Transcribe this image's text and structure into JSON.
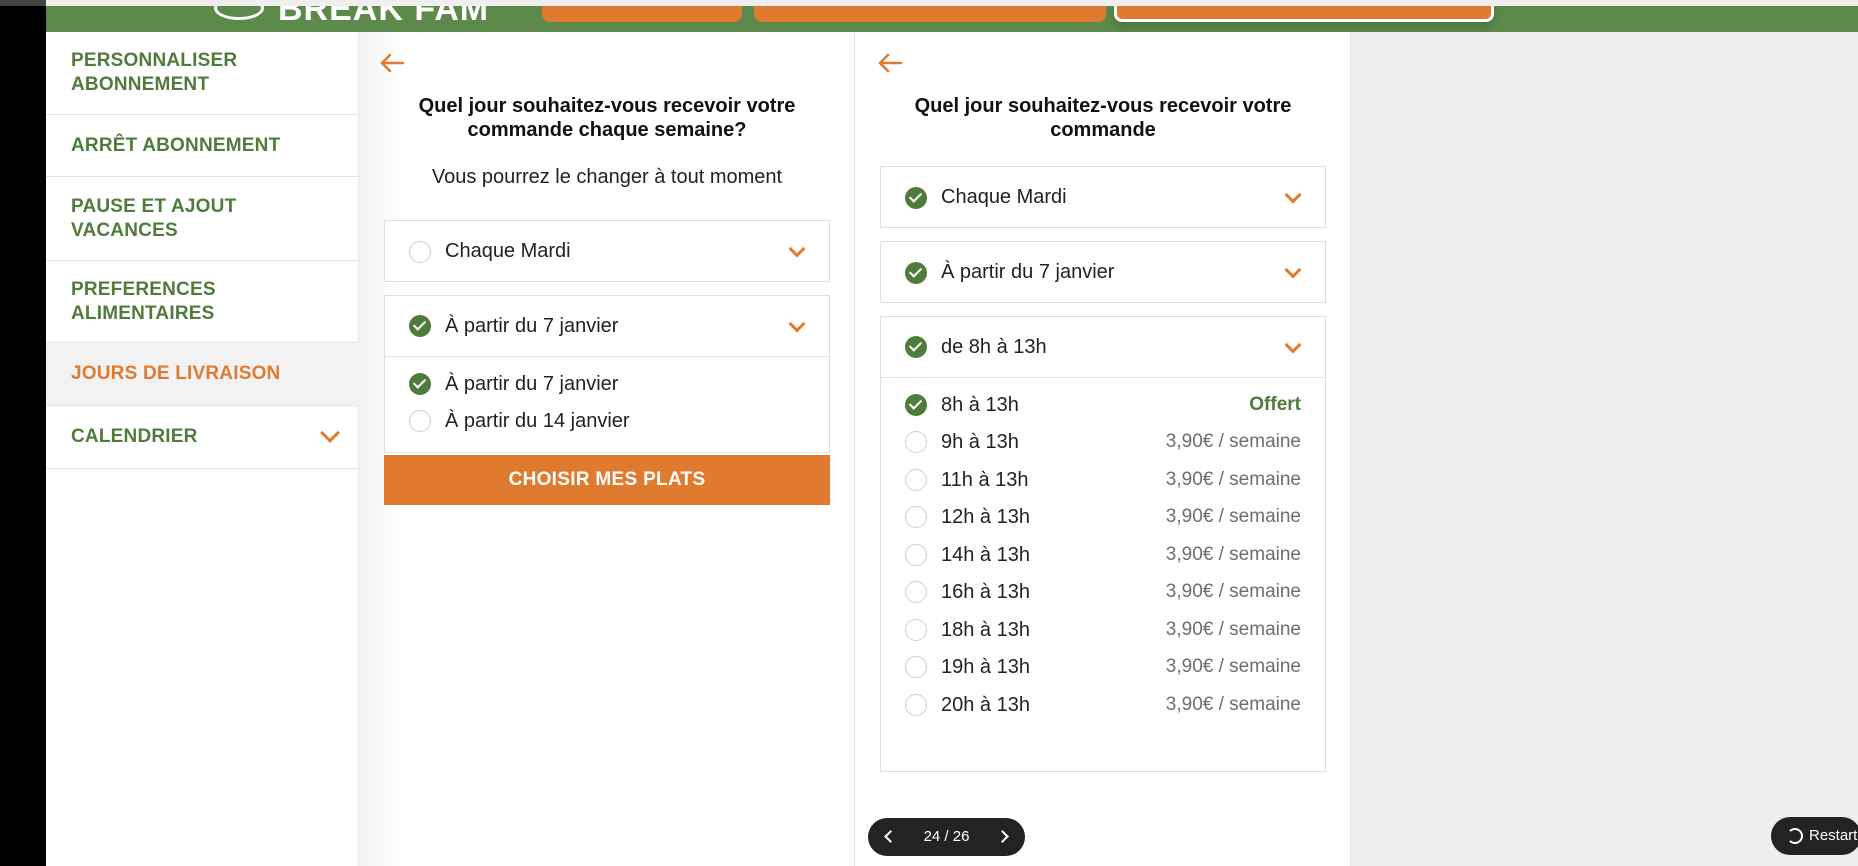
{
  "header": {
    "logo_text": "BREAK FAM"
  },
  "sidebar": {
    "items": [
      {
        "label": "PERSONNALISER ABONNEMENT"
      },
      {
        "label": "ARRÊT ABONNEMENT"
      },
      {
        "label": "PAUSE ET AJOUT VACANCES"
      },
      {
        "label": "PREFERENCES ALIMENTAIRES"
      },
      {
        "label": "JOURS DE LIVRAISON",
        "active": true
      },
      {
        "label": "CALENDRIER"
      }
    ]
  },
  "left_panel": {
    "title": "Quel jour souhaitez-vous recevoir votre commande chaque semaine?",
    "subtitle": "Vous pourrez le changer à tout moment",
    "day_select": {
      "value": "Chaque Mardi",
      "checked": false
    },
    "start_select": {
      "value": "À partir du 7 janvier",
      "checked": true
    },
    "start_options": [
      {
        "label": "À partir du 7 janvier",
        "checked": true
      },
      {
        "label": "À partir du 14 janvier",
        "checked": false
      }
    ],
    "cta_label": "CHOISIR MES PLATS"
  },
  "right_panel": {
    "title": "Quel jour souhaitez-vous recevoir votre commande",
    "day_select": {
      "value": "Chaque Mardi",
      "checked": true
    },
    "start_select": {
      "value": "À partir du 7 janvier",
      "checked": true
    },
    "slot_select": {
      "value": "de 8h à 13h",
      "checked": true
    },
    "slot_options": [
      {
        "label": "8h à 13h",
        "price": "Offert",
        "checked": true
      },
      {
        "label": "9h à 13h",
        "price": "3,90€ / semaine",
        "checked": false
      },
      {
        "label": "11h à 13h",
        "price": "3,90€ / semaine",
        "checked": false
      },
      {
        "label": "12h à 13h",
        "price": "3,90€ / semaine",
        "checked": false
      },
      {
        "label": "14h à 13h",
        "price": "3,90€ / semaine",
        "checked": false
      },
      {
        "label": "16h à 13h",
        "price": "3,90€ / semaine",
        "checked": false
      },
      {
        "label": "18h à 13h",
        "price": "3,90€ / semaine",
        "checked": false
      },
      {
        "label": "19h à 13h",
        "price": "3,90€ / semaine",
        "checked": false
      },
      {
        "label": "20h à 13h",
        "price": "3,90€ / semaine",
        "checked": false
      }
    ]
  },
  "pager": {
    "count": "24 / 26"
  },
  "restart": {
    "label": "Restart"
  },
  "colors": {
    "brand_green": "#4f7b3c",
    "header_green": "#5c8a4a",
    "accent_orange": "#e07a2f"
  }
}
